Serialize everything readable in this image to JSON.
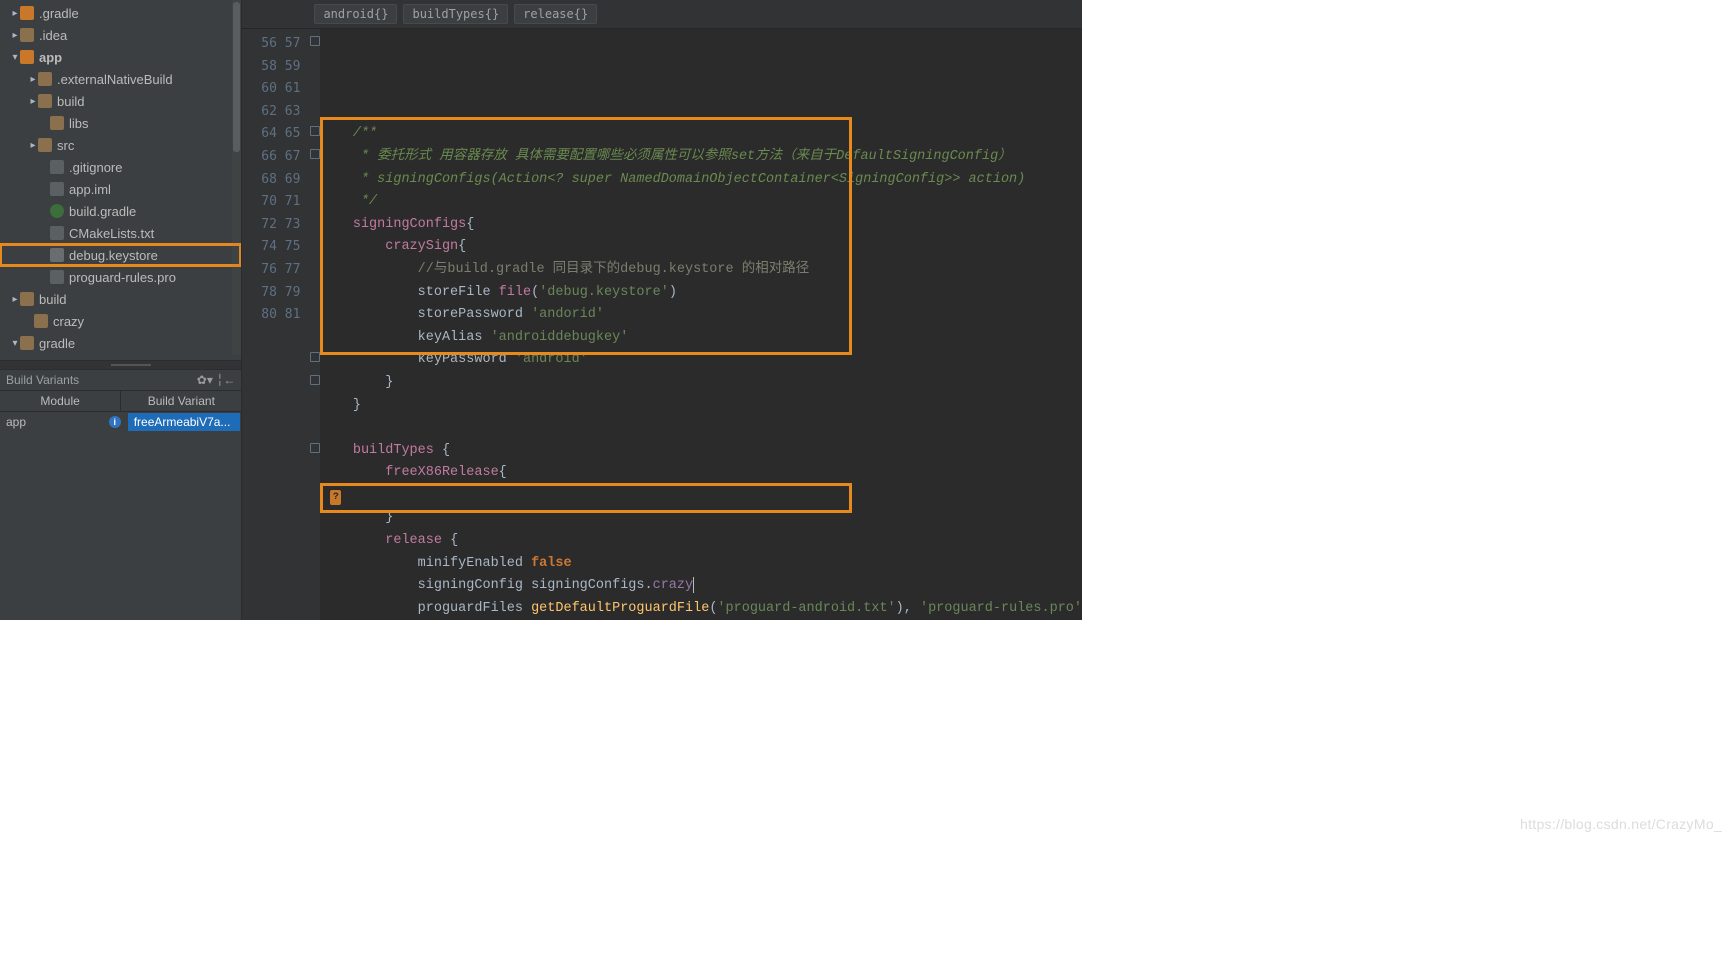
{
  "tree": {
    "items": [
      {
        "pad": 10,
        "arrow": "▸",
        "icon": "folder or",
        "label": ".gradle"
      },
      {
        "pad": 10,
        "arrow": "▸",
        "icon": "folder",
        "label": ".idea"
      },
      {
        "pad": 10,
        "arrow": "▾",
        "icon": "folder or",
        "label": "app",
        "bold": true
      },
      {
        "pad": 28,
        "arrow": "▸",
        "icon": "folder",
        "label": ".externalNativeBuild"
      },
      {
        "pad": 28,
        "arrow": "▸",
        "icon": "folder",
        "label": "build"
      },
      {
        "pad": 40,
        "arrow": "",
        "icon": "folder",
        "label": "libs"
      },
      {
        "pad": 28,
        "arrow": "▸",
        "icon": "folder",
        "label": "src"
      },
      {
        "pad": 40,
        "arrow": "",
        "icon": "file",
        "label": ".gitignore"
      },
      {
        "pad": 40,
        "arrow": "",
        "icon": "file",
        "label": "app.iml"
      },
      {
        "pad": 40,
        "arrow": "",
        "icon": "gradle",
        "label": "build.gradle"
      },
      {
        "pad": 40,
        "arrow": "",
        "icon": "file",
        "label": "CMakeLists.txt"
      },
      {
        "pad": 40,
        "arrow": "",
        "icon": "key",
        "label": "debug.keystore",
        "hl": true
      },
      {
        "pad": 40,
        "arrow": "",
        "icon": "file",
        "label": "proguard-rules.pro"
      },
      {
        "pad": 10,
        "arrow": "▸",
        "icon": "folder",
        "label": "build"
      },
      {
        "pad": 24,
        "arrow": "",
        "icon": "folder",
        "label": "crazy"
      },
      {
        "pad": 10,
        "arrow": "▾",
        "icon": "folder",
        "label": "gradle"
      }
    ]
  },
  "variants": {
    "title": "Build Variants",
    "gear": "✿▾  ╎←",
    "col1": "Module",
    "col2": "Build Variant",
    "mod": "app",
    "var": "freeArmeabiV7a..."
  },
  "crumbs": [
    "android{}",
    "buildTypes{}",
    "release{}"
  ],
  "gutter": {
    "start": 56,
    "end": 81
  },
  "codeLines": [
    [
      {
        "cls": "c-cmt",
        "t": "    /**"
      }
    ],
    [
      {
        "cls": "c-cmt",
        "t": "     * 委托形式 用容器存放 具体需要配置哪些必须属性可以参照set方法（来自于DefaultSigningConfig）"
      }
    ],
    [
      {
        "cls": "c-cmt",
        "t": "     * signingConfigs(Action<? super NamedDomainObjectContainer<SigningConfig>> action)"
      }
    ],
    [
      {
        "cls": "c-cmt",
        "t": "     */"
      }
    ],
    [
      {
        "cls": "c-id",
        "t": "    signingConfigs"
      },
      {
        "cls": "",
        "t": "{"
      }
    ],
    [
      {
        "cls": "c-id",
        "t": "        crazySign"
      },
      {
        "cls": "",
        "t": "{"
      }
    ],
    [
      {
        "cls": "c-dim",
        "t": "            //与build.gradle 同目录下的debug.keystore 的相对路径"
      }
    ],
    [
      {
        "cls": "",
        "t": "            storeFile "
      },
      {
        "cls": "c-fn",
        "t": "file"
      },
      {
        "cls": "",
        "t": "("
      },
      {
        "cls": "c-str",
        "t": "'debug.keystore'"
      },
      {
        "cls": "",
        "t": ")"
      }
    ],
    [
      {
        "cls": "",
        "t": "            storePassword "
      },
      {
        "cls": "c-str",
        "t": "'andorid'"
      }
    ],
    [
      {
        "cls": "",
        "t": "            keyAlias "
      },
      {
        "cls": "c-str",
        "t": "'androiddebugkey'"
      }
    ],
    [
      {
        "cls": "",
        "t": "            keyPassword "
      },
      {
        "cls": "c-str",
        "t": "'android'"
      }
    ],
    [
      {
        "cls": "",
        "t": "        }"
      }
    ],
    [
      {
        "cls": "",
        "t": "    }"
      }
    ],
    [
      {
        "cls": "",
        "t": ""
      }
    ],
    [
      {
        "cls": "c-id",
        "t": "    buildTypes"
      },
      {
        "cls": "",
        "t": " {"
      }
    ],
    [
      {
        "cls": "c-id",
        "t": "        freeX86Release"
      },
      {
        "cls": "",
        "t": "{"
      }
    ],
    [
      {
        "cls": "",
        "t": ""
      }
    ],
    [
      {
        "cls": "",
        "t": "        }"
      }
    ],
    [
      {
        "cls": "c-id",
        "t": "        release"
      },
      {
        "cls": "",
        "t": " {"
      }
    ],
    [
      {
        "cls": "",
        "t": "            minifyEnabled "
      },
      {
        "cls": "c-false",
        "t": "false"
      }
    ],
    [
      {
        "cls": "",
        "t": "            signingConfig "
      },
      {
        "cls": "",
        "t": "signingConfigs."
      },
      {
        "cls": "c-field",
        "t": "crazy"
      },
      {
        "caret": true
      }
    ],
    [
      {
        "cls": "",
        "t": "            proguardFiles "
      },
      {
        "cls": "c-mtd",
        "t": "getDefaultProguardFile"
      },
      {
        "cls": "",
        "t": "("
      },
      {
        "cls": "c-str",
        "t": "'proguard-android.txt'"
      },
      {
        "cls": "",
        "t": "), "
      },
      {
        "cls": "c-str",
        "t": "'proguard-rules.pro'"
      }
    ],
    [
      {
        "cls": "",
        "t": "        }"
      }
    ],
    [
      {
        "cls": "",
        "t": "    }"
      }
    ],
    [
      {
        "cls": "",
        "t": ""
      }
    ],
    [
      {
        "cls": "",
        "t": ""
      }
    ]
  ],
  "watermark": "https://blog.csdn.net/CrazyMo_"
}
